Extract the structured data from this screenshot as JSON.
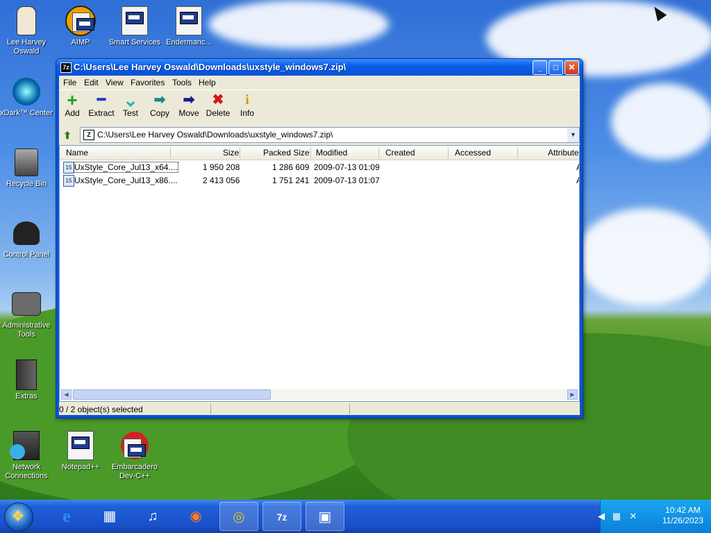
{
  "desktop": {
    "icons": [
      {
        "label": "Lee Harvey Oswald",
        "icon": "user-folder-icon"
      },
      {
        "label": "AIMP",
        "icon": "aimp-icon"
      },
      {
        "label": "Smart Services",
        "icon": "services-icon"
      },
      {
        "label": "Endermanc...",
        "icon": "document-icon"
      },
      {
        "label": "xDark™ Center",
        "icon": "xdark-center-icon"
      },
      {
        "label": "Recycle Bin",
        "icon": "recycle-bin-icon"
      },
      {
        "label": "Control Panel",
        "icon": "control-panel-icon"
      },
      {
        "label": "Administrative Tools",
        "icon": "admin-tools-icon"
      },
      {
        "label": "Extras",
        "icon": "extras-folder-icon"
      },
      {
        "label": "Network Connections",
        "icon": "network-icon"
      },
      {
        "label": "Notepad++",
        "icon": "notepadpp-icon"
      },
      {
        "label": "Embarcadero Dev-C++",
        "icon": "devcpp-icon"
      }
    ]
  },
  "window": {
    "app_icon": "7z",
    "title": "C:\\Users\\Lee Harvey Oswald\\Downloads\\uxstyle_windows7.zip\\",
    "minimize": "_",
    "maximize": "□",
    "close": "✕"
  },
  "menu": [
    "File",
    "Edit",
    "View",
    "Favorites",
    "Tools",
    "Help"
  ],
  "toolbar": [
    {
      "label": "Add",
      "icon": "add-icon",
      "glyph": "+",
      "color": "#1aa81a"
    },
    {
      "label": "Extract",
      "icon": "extract-icon",
      "glyph": "━",
      "color": "#1c3ec4"
    },
    {
      "label": "Test",
      "icon": "test-icon",
      "glyph": "⌄",
      "color": "#1fb5c9"
    },
    {
      "label": "Copy",
      "icon": "copy-icon",
      "glyph": "➡",
      "color": "#1a8a8a"
    },
    {
      "label": "Move",
      "icon": "move-icon",
      "glyph": "➡",
      "color": "#1a1a8a"
    },
    {
      "label": "Delete",
      "icon": "delete-icon",
      "glyph": "✖",
      "color": "#d01818"
    },
    {
      "label": "Info",
      "icon": "info-icon",
      "glyph": "i",
      "color": "#c9a400"
    }
  ],
  "address": {
    "path": "C:\\Users\\Lee Harvey Oswald\\Downloads\\uxstyle_windows7.zip\\"
  },
  "columns": [
    "Name",
    "Size",
    "Packed Size",
    "Modified",
    "Created",
    "Accessed",
    "Attribute"
  ],
  "files": [
    {
      "name": "UxStyle_Core_Jul13_x64....",
      "size": "1 950 208",
      "packed": "1 286 609",
      "modified": "2009-07-13 01:09",
      "created": "",
      "accessed": "",
      "attr": "A"
    },
    {
      "name": "UxStyle_Core_Jul13_x86....",
      "size": "2 413 056",
      "packed": "1 751 241",
      "modified": "2009-07-13 01:07",
      "created": "",
      "accessed": "",
      "attr": "A"
    }
  ],
  "status": {
    "selection": "0 / 2 object(s) selected"
  },
  "taskbar": {
    "apps": [
      {
        "icon": "ie-icon",
        "glyph": "e"
      },
      {
        "icon": "store-icon",
        "glyph": "▦"
      },
      {
        "icon": "music-icon",
        "glyph": "♫"
      },
      {
        "icon": "firefox-icon",
        "glyph": "◉"
      },
      {
        "icon": "chrome-icon",
        "glyph": "◎"
      },
      {
        "icon": "7zip-icon",
        "glyph": "7z"
      },
      {
        "icon": "window-icon",
        "glyph": "▣"
      }
    ],
    "time": "10:42 AM",
    "date": "11/26/2023"
  }
}
